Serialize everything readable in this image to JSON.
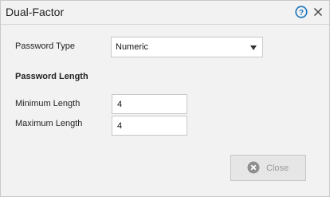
{
  "dialog": {
    "title": "Dual-Factor"
  },
  "form": {
    "password_type_label": "Password Type",
    "password_type_value": "Numeric",
    "password_length_heading": "Password Length",
    "minimum_length_label": "Minimum Length",
    "minimum_length_value": "4",
    "maximum_length_label": "Maximum Length",
    "maximum_length_value": "4"
  },
  "footer": {
    "close_label": "Close"
  },
  "icons": {
    "help": "help-icon",
    "close": "close-icon",
    "close_button": "close-circle-icon"
  },
  "colors": {
    "accent": "#1b75bb",
    "button_icon": "#8f8f8f"
  }
}
